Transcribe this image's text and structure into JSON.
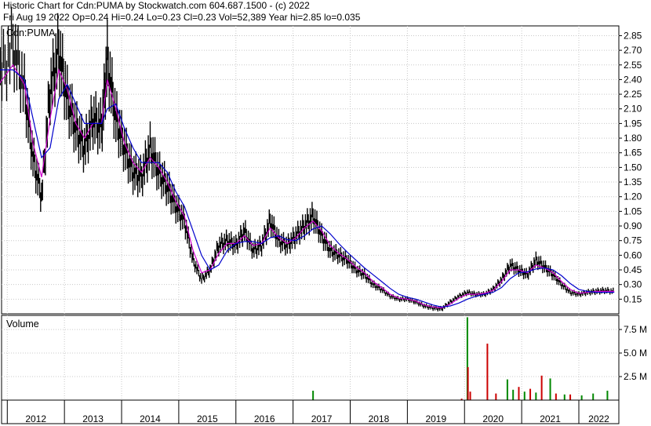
{
  "header": {
    "line1": "Historic Chart for Cdn:PUMA by Stockwatch.com 604.687.1500 - (c) 2022",
    "line2": "Fri Aug 19 2022   Op=0.24   Hi=0.24   Lo=0.23   Cl=0.23   Vol=52,389   Year hi=2.85   lo=0.035"
  },
  "chart_data": [
    {
      "type": "line",
      "title": "Cdn:PUMA",
      "ylim": [
        0,
        2.95
      ],
      "yticks": [
        "2.85",
        "2.70",
        "2.55",
        "2.40",
        "2.25",
        "2.10",
        "1.95",
        "1.80",
        "1.65",
        "1.50",
        "1.35",
        "1.20",
        "1.05",
        "0.90",
        "0.75",
        "0.60",
        "0.45",
        "0.30",
        "0.15"
      ],
      "x_labels": [
        "2012",
        "2013",
        "2014",
        "2015",
        "2016",
        "2017",
        "2018",
        "2019",
        "2020",
        "2021",
        "2022"
      ],
      "series": [
        {
          "name": "",
          "role": "price",
          "color": "#000000",
          "x": [
            2011.85,
            2012.1,
            2012.3,
            2012.45,
            2012.6,
            2012.75,
            2012.9,
            2013.05,
            2013.2,
            2013.35,
            2013.5,
            2013.65,
            2013.75,
            2013.9,
            2014.05,
            2014.2,
            2014.35,
            2014.5,
            2014.65,
            2014.8,
            2014.95,
            2015.1,
            2015.25,
            2015.4,
            2015.55,
            2015.7,
            2015.85,
            2016.0,
            2016.15,
            2016.3,
            2016.45,
            2016.6,
            2016.75,
            2016.9,
            2017.05,
            2017.2,
            2017.35,
            2017.5,
            2017.65,
            2017.8,
            2017.95,
            2018.1,
            2018.25,
            2018.4,
            2018.55,
            2018.7,
            2018.85,
            2019.0,
            2019.15,
            2019.3,
            2019.45,
            2019.6,
            2019.75,
            2019.9,
            2020.05,
            2020.2,
            2020.35,
            2020.5,
            2020.65,
            2020.8,
            2020.95,
            2021.1,
            2021.25,
            2021.4,
            2021.55,
            2021.7,
            2021.85,
            2022.0,
            2022.15,
            2022.3,
            2022.45,
            2022.62
          ],
          "y": [
            2.4,
            2.75,
            2.3,
            1.6,
            1.2,
            2.3,
            2.7,
            2.2,
            1.9,
            1.7,
            2.0,
            1.9,
            2.6,
            2.0,
            1.7,
            1.45,
            1.4,
            1.7,
            1.45,
            1.3,
            1.1,
            0.95,
            0.55,
            0.35,
            0.45,
            0.7,
            0.75,
            0.7,
            0.85,
            0.65,
            0.7,
            0.95,
            0.75,
            0.7,
            0.8,
            0.9,
            1.0,
            0.8,
            0.65,
            0.6,
            0.55,
            0.45,
            0.4,
            0.3,
            0.25,
            0.18,
            0.15,
            0.15,
            0.12,
            0.08,
            0.06,
            0.05,
            0.12,
            0.18,
            0.22,
            0.2,
            0.2,
            0.25,
            0.35,
            0.5,
            0.45,
            0.4,
            0.55,
            0.48,
            0.4,
            0.3,
            0.22,
            0.2,
            0.22,
            0.23,
            0.24,
            0.23
          ]
        },
        {
          "name": "",
          "role": "short-ma",
          "color": "#cc00cc",
          "x": [
            2011.85,
            2012.1,
            2012.3,
            2012.45,
            2012.6,
            2012.75,
            2012.9,
            2013.05,
            2013.2,
            2013.35,
            2013.5,
            2013.65,
            2013.75,
            2013.9,
            2014.05,
            2014.2,
            2014.35,
            2014.5,
            2014.65,
            2014.8,
            2014.95,
            2015.1,
            2015.25,
            2015.4,
            2015.55,
            2015.7,
            2015.85,
            2016.0,
            2016.15,
            2016.3,
            2016.45,
            2016.6,
            2016.75,
            2016.9,
            2017.05,
            2017.2,
            2017.35,
            2017.5,
            2017.65,
            2017.8,
            2017.95,
            2018.1,
            2018.25,
            2018.4,
            2018.55,
            2018.7,
            2018.85,
            2019.0,
            2019.15,
            2019.3,
            2019.45,
            2019.6,
            2019.75,
            2019.9,
            2020.05,
            2020.2,
            2020.35,
            2020.5,
            2020.65,
            2020.8,
            2020.95,
            2021.1,
            2021.25,
            2021.4,
            2021.55,
            2021.7,
            2021.85,
            2022.0,
            2022.15,
            2022.3,
            2022.45,
            2022.62
          ],
          "y": [
            2.35,
            2.55,
            2.35,
            1.75,
            1.4,
            2.0,
            2.5,
            2.3,
            1.95,
            1.8,
            1.95,
            1.95,
            2.4,
            2.1,
            1.75,
            1.55,
            1.45,
            1.6,
            1.5,
            1.35,
            1.15,
            1.0,
            0.65,
            0.42,
            0.45,
            0.62,
            0.72,
            0.72,
            0.8,
            0.7,
            0.72,
            0.88,
            0.78,
            0.72,
            0.78,
            0.88,
            0.95,
            0.85,
            0.7,
            0.62,
            0.56,
            0.48,
            0.42,
            0.33,
            0.27,
            0.2,
            0.16,
            0.15,
            0.13,
            0.09,
            0.07,
            0.06,
            0.1,
            0.16,
            0.2,
            0.2,
            0.21,
            0.24,
            0.33,
            0.45,
            0.45,
            0.42,
            0.5,
            0.47,
            0.42,
            0.33,
            0.25,
            0.21,
            0.22,
            0.23,
            0.23,
            0.23
          ]
        },
        {
          "name": "",
          "role": "long-ma",
          "color": "#0000cc",
          "x": [
            2011.85,
            2012.1,
            2012.3,
            2012.45,
            2012.6,
            2012.75,
            2012.9,
            2013.05,
            2013.2,
            2013.35,
            2013.5,
            2013.65,
            2013.75,
            2013.9,
            2014.05,
            2014.2,
            2014.35,
            2014.5,
            2014.65,
            2014.8,
            2014.95,
            2015.1,
            2015.25,
            2015.4,
            2015.55,
            2015.7,
            2015.85,
            2016.0,
            2016.15,
            2016.3,
            2016.45,
            2016.6,
            2016.75,
            2016.9,
            2017.05,
            2017.2,
            2017.35,
            2017.5,
            2017.65,
            2017.8,
            2017.95,
            2018.1,
            2018.25,
            2018.4,
            2018.55,
            2018.7,
            2018.85,
            2019.0,
            2019.15,
            2019.3,
            2019.45,
            2019.6,
            2019.75,
            2019.9,
            2020.05,
            2020.2,
            2020.35,
            2020.5,
            2020.65,
            2020.8,
            2020.95,
            2021.1,
            2021.25,
            2021.4,
            2021.55,
            2021.7,
            2021.85,
            2022.0,
            2022.15,
            2022.3,
            2022.45,
            2022.62
          ],
          "y": [
            2.5,
            2.5,
            2.4,
            2.0,
            1.6,
            1.7,
            2.2,
            2.35,
            2.15,
            1.95,
            1.95,
            1.95,
            2.1,
            2.15,
            1.9,
            1.7,
            1.55,
            1.55,
            1.55,
            1.45,
            1.25,
            1.1,
            0.85,
            0.6,
            0.45,
            0.5,
            0.65,
            0.72,
            0.74,
            0.74,
            0.72,
            0.78,
            0.8,
            0.76,
            0.75,
            0.8,
            0.87,
            0.9,
            0.82,
            0.72,
            0.63,
            0.55,
            0.47,
            0.4,
            0.33,
            0.26,
            0.2,
            0.17,
            0.15,
            0.12,
            0.09,
            0.07,
            0.08,
            0.11,
            0.15,
            0.18,
            0.2,
            0.22,
            0.27,
            0.36,
            0.42,
            0.43,
            0.46,
            0.47,
            0.45,
            0.39,
            0.31,
            0.25,
            0.23,
            0.22,
            0.22,
            0.22
          ]
        }
      ]
    },
    {
      "type": "bar",
      "title": "Volume",
      "ylim": [
        0,
        9000000
      ],
      "yticks": [
        "7.5 M",
        "5.0 M",
        "2.5 M"
      ],
      "bars": [
        {
          "x": 2017.35,
          "v": 1000000,
          "color": "#008800"
        },
        {
          "x": 2019.95,
          "v": 150000,
          "color": "#cc0000"
        },
        {
          "x": 2020.05,
          "v": 8800000,
          "color": "#008800"
        },
        {
          "x": 2020.06,
          "v": 3500000,
          "color": "#cc0000"
        },
        {
          "x": 2020.1,
          "v": 900000,
          "color": "#cc0000"
        },
        {
          "x": 2020.4,
          "v": 6000000,
          "color": "#cc0000"
        },
        {
          "x": 2020.55,
          "v": 700000,
          "color": "#cc0000"
        },
        {
          "x": 2020.75,
          "v": 2200000,
          "color": "#008800"
        },
        {
          "x": 2020.85,
          "v": 1100000,
          "color": "#008800"
        },
        {
          "x": 2020.95,
          "v": 1400000,
          "color": "#cc0000"
        },
        {
          "x": 2021.05,
          "v": 900000,
          "color": "#008800"
        },
        {
          "x": 2021.15,
          "v": 1200000,
          "color": "#cc0000"
        },
        {
          "x": 2021.25,
          "v": 800000,
          "color": "#008800"
        },
        {
          "x": 2021.35,
          "v": 2600000,
          "color": "#cc0000"
        },
        {
          "x": 2021.5,
          "v": 2300000,
          "color": "#008800"
        },
        {
          "x": 2021.6,
          "v": 700000,
          "color": "#cc0000"
        },
        {
          "x": 2021.75,
          "v": 600000,
          "color": "#008800"
        },
        {
          "x": 2021.85,
          "v": 600000,
          "color": "#cc0000"
        },
        {
          "x": 2022.05,
          "v": 500000,
          "color": "#008800"
        },
        {
          "x": 2022.25,
          "v": 700000,
          "color": "#008800"
        },
        {
          "x": 2022.5,
          "v": 1000000,
          "color": "#008800"
        }
      ]
    }
  ]
}
